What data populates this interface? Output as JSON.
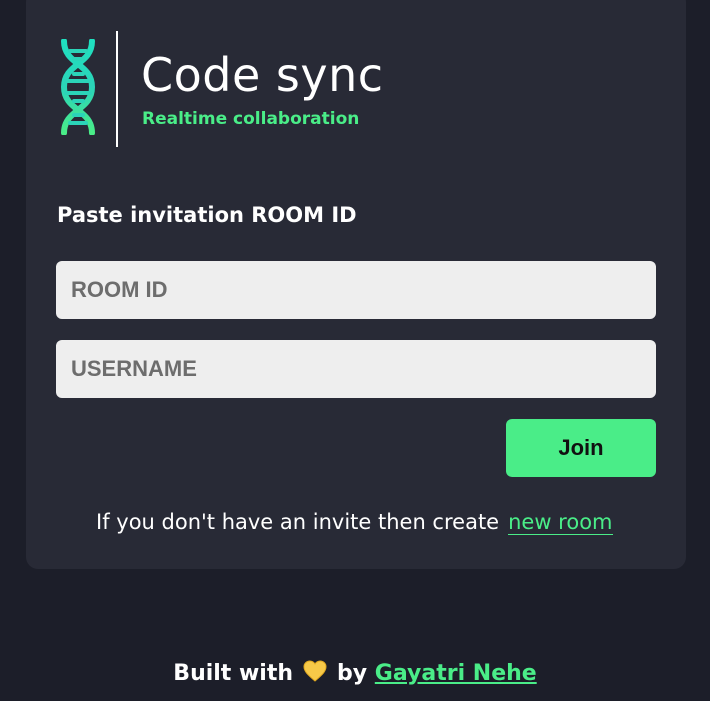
{
  "brand": {
    "title": "Code sync",
    "subtitle": "Realtime collaboration",
    "icon": "dna-icon",
    "accent_color": "#4aed88"
  },
  "form": {
    "heading": "Paste invitation ROOM ID",
    "room_id": {
      "value": "",
      "placeholder": "ROOM ID"
    },
    "username": {
      "value": "",
      "placeholder": "USERNAME"
    },
    "join_label": "Join"
  },
  "invite": {
    "text": "If you don't have an invite then create",
    "link_label": "new room"
  },
  "footer": {
    "built_with": "Built with",
    "heart_icon": "yellow-heart-icon",
    "by": "by",
    "author": "Gayatri Nehe"
  }
}
